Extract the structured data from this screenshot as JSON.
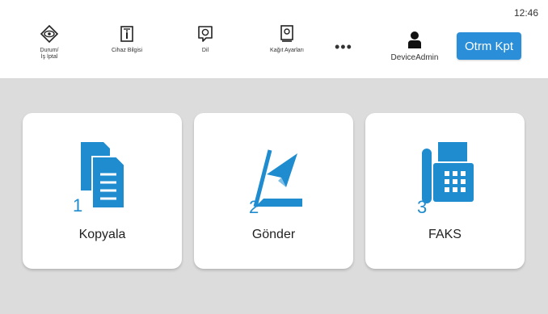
{
  "status": {
    "time": "12:46"
  },
  "toolbar": {
    "items": [
      {
        "label": "Durum/\nİş İptal",
        "icon": "eye-icon"
      },
      {
        "label": "Cihaz Bilgisi",
        "icon": "device-info-icon"
      },
      {
        "label": "Dil",
        "icon": "language-icon"
      },
      {
        "label": "Kağıt Ayarları",
        "icon": "paper-settings-icon"
      }
    ],
    "more": "•••",
    "user": {
      "name": "DeviceAdmin",
      "icon": "user-icon"
    },
    "logout_label": "Otrm Kpt"
  },
  "tiles": [
    {
      "number": "1",
      "label": "Kopyala",
      "icon": "copy-icon"
    },
    {
      "number": "2",
      "label": "Gönder",
      "icon": "send-icon"
    },
    {
      "number": "3",
      "label": "FAKS",
      "icon": "fax-icon"
    }
  ],
  "colors": {
    "accent": "#2a8fd8",
    "icon_blue": "#1e8ccf",
    "background": "#dcdcdc"
  }
}
